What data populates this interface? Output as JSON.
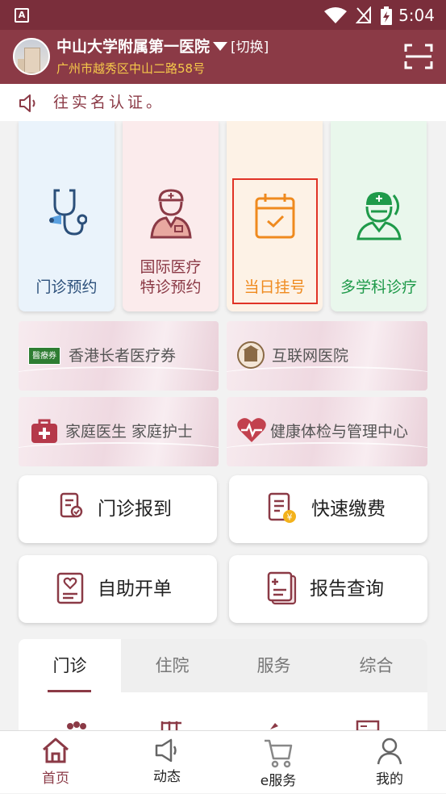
{
  "status_bar": {
    "time": "5:04",
    "app_icon_letter": "A"
  },
  "header": {
    "hospital_name": "中山大学附属第一医院",
    "switch_label": "[切换]",
    "address": "广州市越秀区中山二路58号"
  },
  "notice": {
    "text": "往实名认证。"
  },
  "services": [
    {
      "label_lines": [
        "门诊预约"
      ],
      "icon": "stethoscope-icon",
      "bg": "#eaf3fb",
      "color": "#2b4f7a"
    },
    {
      "label_lines": [
        "国际医疗",
        "特诊预约"
      ],
      "icon": "nurse-icon",
      "bg": "#fbebec",
      "color": "#8b3a46"
    },
    {
      "label_lines": [
        "当日挂号"
      ],
      "icon": "calendar-check-icon",
      "bg": "#fdf2e6",
      "color": "#ef8a1e"
    },
    {
      "label_lines": [
        "多学科诊疗"
      ],
      "icon": "doctor-icon",
      "bg": "#e9f7ec",
      "color": "#1f9a4a"
    }
  ],
  "banners": [
    {
      "text": "香港长者医疗券",
      "badge": "醫療券"
    },
    {
      "text": "互联网医院"
    },
    {
      "text": "家庭医生 家庭护士"
    },
    {
      "text": "健康体检与管理中心"
    }
  ],
  "quick_actions": [
    {
      "label": "门诊报到",
      "icon": "checkin-icon"
    },
    {
      "label": "快速缴费",
      "icon": "payment-icon"
    },
    {
      "label": "自助开单",
      "icon": "self-order-icon"
    },
    {
      "label": "报告查询",
      "icon": "report-icon"
    }
  ],
  "tabs": [
    {
      "label": "门诊",
      "active": true
    },
    {
      "label": "住院",
      "active": false
    },
    {
      "label": "服务",
      "active": false
    },
    {
      "label": "综合",
      "active": false
    }
  ],
  "bottom_nav": [
    {
      "label": "首页",
      "active": true,
      "icon": "home-icon"
    },
    {
      "label": "动态",
      "active": false,
      "icon": "megaphone-icon"
    },
    {
      "label": "e服务",
      "active": false,
      "icon": "cart-icon"
    },
    {
      "label": "我的",
      "active": false,
      "icon": "person-icon"
    }
  ],
  "colors": {
    "brand": "#8b3a46",
    "accent_yellow": "#f5c84a",
    "highlight_border": "#e03326"
  }
}
